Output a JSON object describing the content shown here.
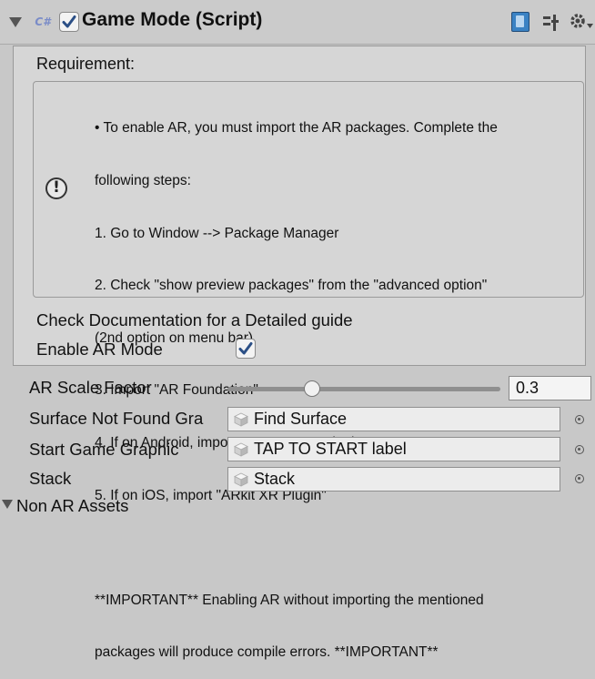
{
  "component": {
    "title": "Game Mode (Script)",
    "script_icon_label": "C#",
    "enabled": true
  },
  "help": {
    "heading": "Requirement:",
    "lines": [
      "• To enable AR, you must import the AR packages. Complete the",
      "following steps:",
      "1. Go to Window --> Package Manager",
      "2. Check \"show preview packages\" from the \"advanced option\"",
      "(2nd option on menu bar)",
      "3. Import \"AR Foundation\"",
      "4. If on Android, import \"ARCore XR Plugin\"",
      "5. If on iOS, import \"ARkit XR Plugin\"",
      "",
      "**IMPORTANT** Enabling AR without importing the mentioned",
      "packages will produce compile errors. **IMPORTANT**"
    ],
    "documentation": "Check Documentation for a Detailed guide"
  },
  "enable_ar": {
    "label": "Enable AR Mode",
    "checked": true
  },
  "properties": {
    "ar_scale": {
      "label": "AR Scale Factor",
      "value": "0.3",
      "slider_fraction": 0.31
    },
    "surface_not_found": {
      "label": "Surface Not Found Gra",
      "value": "Find Surface"
    },
    "start_game_graphic": {
      "label": "Start Game Graphic",
      "value": "TAP TO START label"
    },
    "stack": {
      "label": "Stack",
      "value": "Stack"
    }
  },
  "foldout": {
    "label": "Non AR Assets"
  },
  "colors": {
    "panel_bg": "#c8c8c8",
    "check_blue": "#2b4f86"
  }
}
